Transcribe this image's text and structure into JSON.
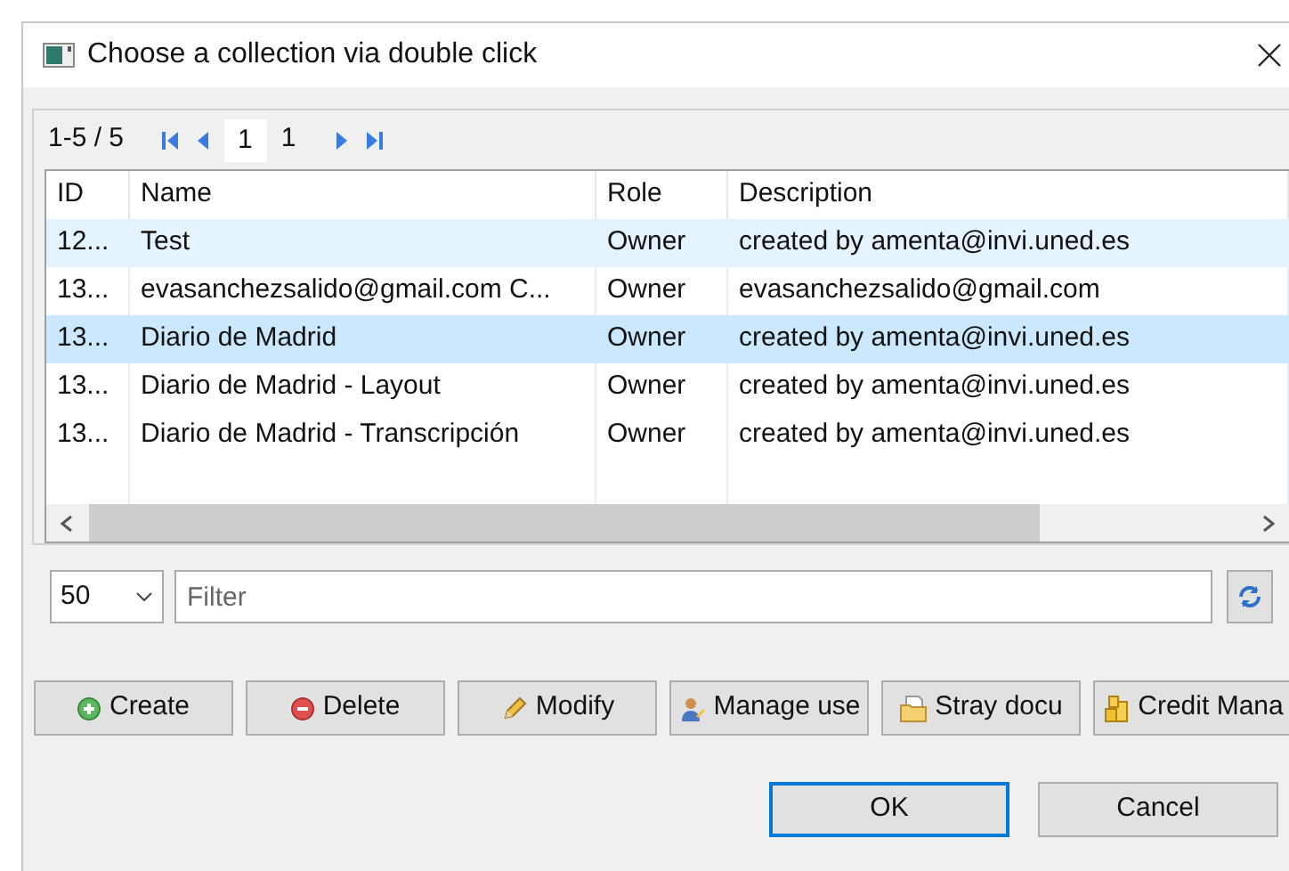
{
  "window": {
    "title": "Choose a collection via double click"
  },
  "pager": {
    "range": "1-5 / 5",
    "page": "1",
    "page_count": "1"
  },
  "table": {
    "columns": [
      "ID",
      "Name",
      "Role",
      "Description"
    ],
    "rows": [
      {
        "cells": [
          "12...",
          "Test",
          "Owner",
          "created by amenta@invi.uned.es"
        ],
        "selected": false,
        "hovered": true
      },
      {
        "cells": [
          "13...",
          "evasanchezsalido@gmail.com C...",
          "Owner",
          "evasanchezsalido@gmail.com"
        ],
        "selected": false,
        "hovered": false
      },
      {
        "cells": [
          "13...",
          "Diario de Madrid",
          "Owner",
          "created by amenta@invi.uned.es"
        ],
        "selected": true,
        "hovered": false
      },
      {
        "cells": [
          "13...",
          "Diario de Madrid - Layout",
          "Owner",
          "created by amenta@invi.uned.es"
        ],
        "selected": false,
        "hovered": false
      },
      {
        "cells": [
          "13...",
          "Diario de Madrid - Transcripción",
          "Owner",
          "created by amenta@invi.uned.es"
        ],
        "selected": false,
        "hovered": false
      }
    ]
  },
  "page_size": "50",
  "filter": {
    "placeholder": "Filter"
  },
  "actions": [
    {
      "kind": "create",
      "label": "Create"
    },
    {
      "kind": "delete",
      "label": "Delete"
    },
    {
      "kind": "modify",
      "label": "Modify"
    },
    {
      "kind": "users",
      "label": "Manage use"
    },
    {
      "kind": "stray",
      "label": "Stray docu"
    },
    {
      "kind": "credit",
      "label": "Credit Mana"
    }
  ],
  "dialog_buttons": [
    {
      "label": "OK",
      "default": true
    },
    {
      "label": "Cancel",
      "default": false
    }
  ]
}
